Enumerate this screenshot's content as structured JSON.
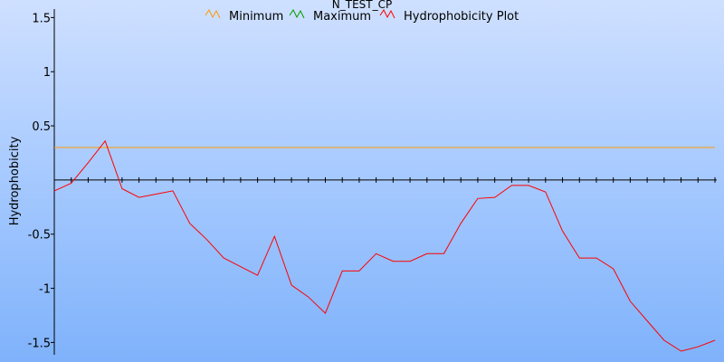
{
  "chart_data": {
    "type": "line",
    "title": "N_TEST_CP",
    "ylabel": "Hydrophobicity",
    "xlabel": "",
    "ylim": [
      -1.58,
      1.52
    ],
    "yticks": [
      {
        "value": 1.5,
        "label": "1.5"
      },
      {
        "value": 1,
        "label": "1"
      },
      {
        "value": 0.5,
        "label": "0.5"
      },
      {
        "value": -0.5,
        "label": "-0.5"
      },
      {
        "value": -1,
        "label": "-1"
      },
      {
        "value": -1.5,
        "label": "-1.5"
      }
    ],
    "xlim": [
      0,
      39
    ],
    "x_ticks": [
      0,
      1,
      2,
      3,
      4,
      5,
      6,
      7,
      8,
      9,
      10,
      11,
      12,
      13,
      14,
      15,
      16,
      17,
      18,
      19,
      20,
      21,
      22,
      23,
      24,
      25,
      26,
      27,
      28,
      29,
      30,
      31,
      32,
      33,
      34,
      35,
      36,
      37,
      38,
      39
    ],
    "legend_position": "top",
    "series": [
      {
        "name": "Minimum",
        "color": "#ff9900",
        "x": [
          0,
          39
        ],
        "values": [
          0.3,
          0.3
        ]
      },
      {
        "name": "Maximum",
        "color": "#009900",
        "x": [],
        "values": []
      },
      {
        "name": "Hydrophobicity Plot",
        "color": "#ff0000",
        "x": [
          0,
          1,
          2,
          3,
          4,
          5,
          6,
          7,
          8,
          9,
          10,
          11,
          12,
          13,
          14,
          15,
          16,
          17,
          18,
          19,
          20,
          21,
          22,
          23,
          24,
          25,
          26,
          27,
          28,
          29,
          30,
          31,
          32,
          33,
          34,
          35,
          36,
          37,
          38,
          39
        ],
        "values": [
          -0.1,
          -0.03,
          0.16,
          0.36,
          -0.08,
          -0.16,
          -0.13,
          -0.1,
          -0.4,
          -0.55,
          -0.72,
          -0.8,
          -0.88,
          -0.52,
          -0.97,
          -1.08,
          -1.23,
          -0.84,
          -0.84,
          -0.68,
          -0.75,
          -0.75,
          -0.68,
          -0.68,
          -0.4,
          -0.17,
          -0.16,
          -0.05,
          -0.05,
          -0.11,
          -0.47,
          -0.72,
          -0.72,
          -0.82,
          -1.12,
          -1.3,
          -1.48,
          -1.58,
          -1.54,
          -1.48
        ]
      }
    ]
  }
}
